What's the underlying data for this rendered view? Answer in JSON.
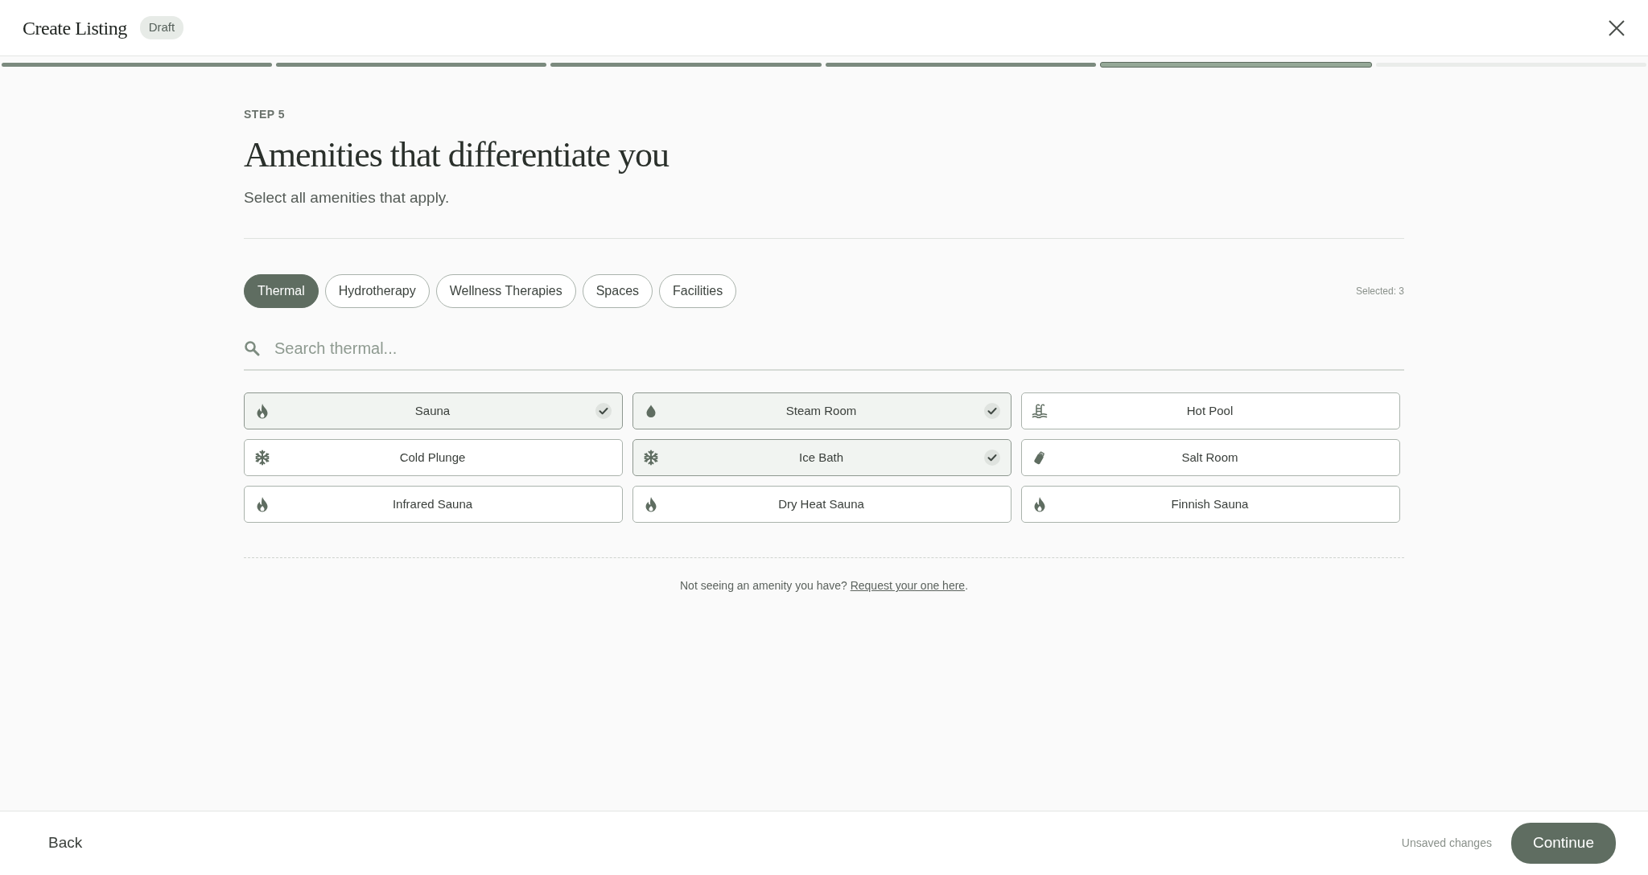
{
  "header": {
    "title": "Create Listing",
    "badge": "Draft"
  },
  "progress": [
    {
      "done": true,
      "selected": false
    },
    {
      "done": true,
      "selected": false
    },
    {
      "done": true,
      "selected": false
    },
    {
      "done": true,
      "selected": false
    },
    {
      "done": true,
      "selected": true
    },
    {
      "done": false,
      "selected": false
    }
  ],
  "step_label": "STEP 5",
  "heading": "Amenities that differentiate you",
  "subtitle": "Select all amenities that apply.",
  "tabs": [
    {
      "label": "Thermal",
      "selected": true
    },
    {
      "label": "Hydrotherapy",
      "selected": false
    },
    {
      "label": "Wellness Therapies",
      "selected": false
    },
    {
      "label": "Spaces",
      "selected": false
    },
    {
      "label": "Facilities",
      "selected": false
    }
  ],
  "selected_count": "Selected: 3",
  "search": {
    "placeholder": "Search thermal..."
  },
  "amenities": [
    {
      "label": "Sauna",
      "kind": "flame",
      "selected": true
    },
    {
      "label": "Steam Room",
      "kind": "drop",
      "selected": true
    },
    {
      "label": "Hot Pool",
      "kind": "pool",
      "selected": false
    },
    {
      "label": "Cold Plunge",
      "kind": "snowflake",
      "selected": false
    },
    {
      "label": "Ice Bath",
      "kind": "snowflake",
      "selected": true
    },
    {
      "label": "Salt Room",
      "kind": "salt",
      "selected": false
    },
    {
      "label": "Infrared Sauna",
      "kind": "flame",
      "selected": false
    },
    {
      "label": "Dry Heat Sauna",
      "kind": "flame",
      "selected": false
    },
    {
      "label": "Finnish Sauna",
      "kind": "flame",
      "selected": false
    }
  ],
  "request_note": {
    "text": "Not seeing an amenity you have?",
    "link": "Request your one here",
    "end": "."
  },
  "footer": {
    "back": "Back",
    "status": "Unsaved changes",
    "continue": "Continue"
  }
}
